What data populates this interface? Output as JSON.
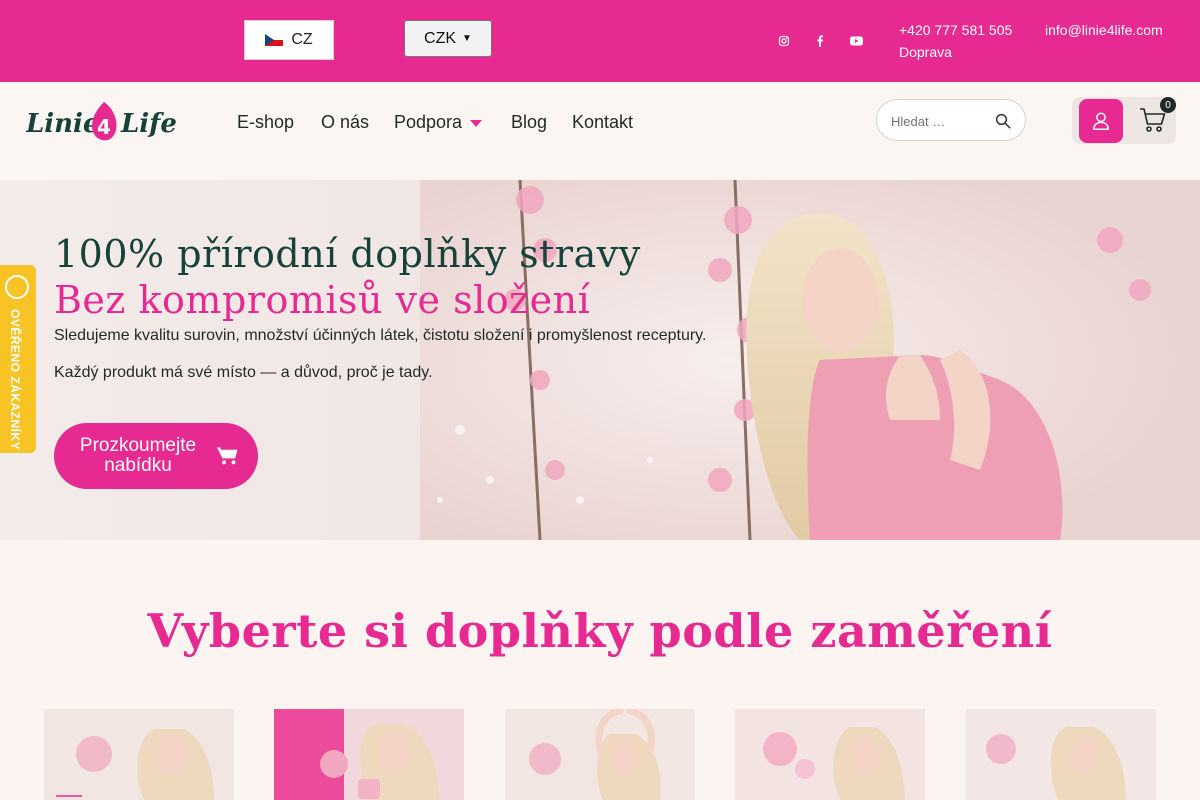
{
  "topbar": {
    "language": "CZ",
    "currency": "CZK",
    "phone": "+420 777 581 505",
    "email": "info@linie4life.com",
    "shipping": "Doprava",
    "social_icons": [
      "instagram-icon",
      "facebook-icon",
      "youtube-icon"
    ]
  },
  "header": {
    "logo_text": "Linie4Life",
    "nav": [
      {
        "label": "E-shop"
      },
      {
        "label": "O nás"
      },
      {
        "label": "Podpora"
      },
      {
        "label": "Blog"
      },
      {
        "label": "Kontakt"
      }
    ],
    "search_placeholder": "Hledat …",
    "cart_count": "0"
  },
  "hero": {
    "title_line1": "100% přírodní doplňky stravy",
    "title_line2": "Bez kompromisů ve složení",
    "text1": "Sledujeme kvalitu surovin, množství účinných látek, čistotu složení i promyšlenost receptury.",
    "text2": "Každý produkt má své místo — a důvod, proč je tady.",
    "cta": "Prozkoumejte nabídku"
  },
  "verified_badge": "OVĚŘENO ZÁKAZNÍKY",
  "section": {
    "title": "Vyberte si doplňky podle zaměření"
  },
  "colors": {
    "brand_pink": "#e62a91",
    "dark_green": "#17423a",
    "badge_yellow": "#f8c325",
    "page_bg": "#fbf4f0"
  }
}
